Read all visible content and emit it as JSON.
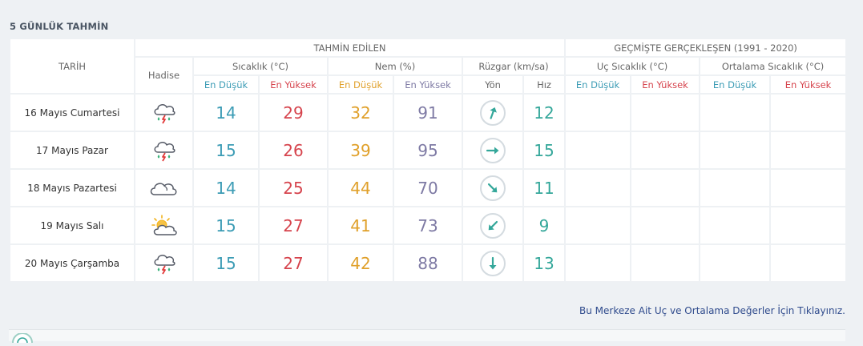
{
  "title": "5 GÜNLÜK TAHMİN",
  "headers": {
    "tarih": "TARİH",
    "tahmin": "TAHMİN EDİLEN",
    "gecmis": "GEÇMİŞTE GERÇEKLEŞEN (1991 - 2020)",
    "hadise": "Hadise",
    "sicaklik": "Sıcaklık (°C)",
    "nem": "Nem (%)",
    "ruzgar": "Rüzgar (km/sa)",
    "uc": "Uç Sıcaklık (°C)",
    "ortalama": "Ortalama Sıcaklık (°C)",
    "en_dusuk": "En Düşük",
    "en_yuksek": "En Yüksek",
    "yon": "Yön",
    "hiz": "Hız"
  },
  "days": [
    {
      "date": "16 Mayıs Cumartesi",
      "icon": "thunderstorm-rain-icon",
      "min": "14",
      "max": "29",
      "hum_min": "32",
      "hum_max": "91",
      "wind_dir_deg": 20,
      "wind_speed": "12"
    },
    {
      "date": "17 Mayıs Pazar",
      "icon": "thunderstorm-rain-icon",
      "min": "15",
      "max": "26",
      "hum_min": "39",
      "hum_max": "95",
      "wind_dir_deg": 90,
      "wind_speed": "15"
    },
    {
      "date": "18 Mayıs Pazartesi",
      "icon": "cloudy-icon",
      "min": "14",
      "max": "25",
      "hum_min": "44",
      "hum_max": "70",
      "wind_dir_deg": 135,
      "wind_speed": "11"
    },
    {
      "date": "19 Mayıs Salı",
      "icon": "partly-cloudy-icon",
      "min": "15",
      "max": "27",
      "hum_min": "41",
      "hum_max": "73",
      "wind_dir_deg": 225,
      "wind_speed": "9"
    },
    {
      "date": "20 Mayıs Çarşamba",
      "icon": "thunderstorm-rain-icon",
      "min": "15",
      "max": "27",
      "hum_min": "42",
      "hum_max": "88",
      "wind_dir_deg": 180,
      "wind_speed": "13"
    }
  ],
  "footer_link": "Bu Merkeze Ait Uç ve Ortalama Değerler İçin Tıklayınız.",
  "colors": {
    "low": "#3c9cb5",
    "high": "#d6444d",
    "hum_low": "#e0a02a",
    "hum_high": "#7e7aa4",
    "wind": "#34a79a"
  }
}
